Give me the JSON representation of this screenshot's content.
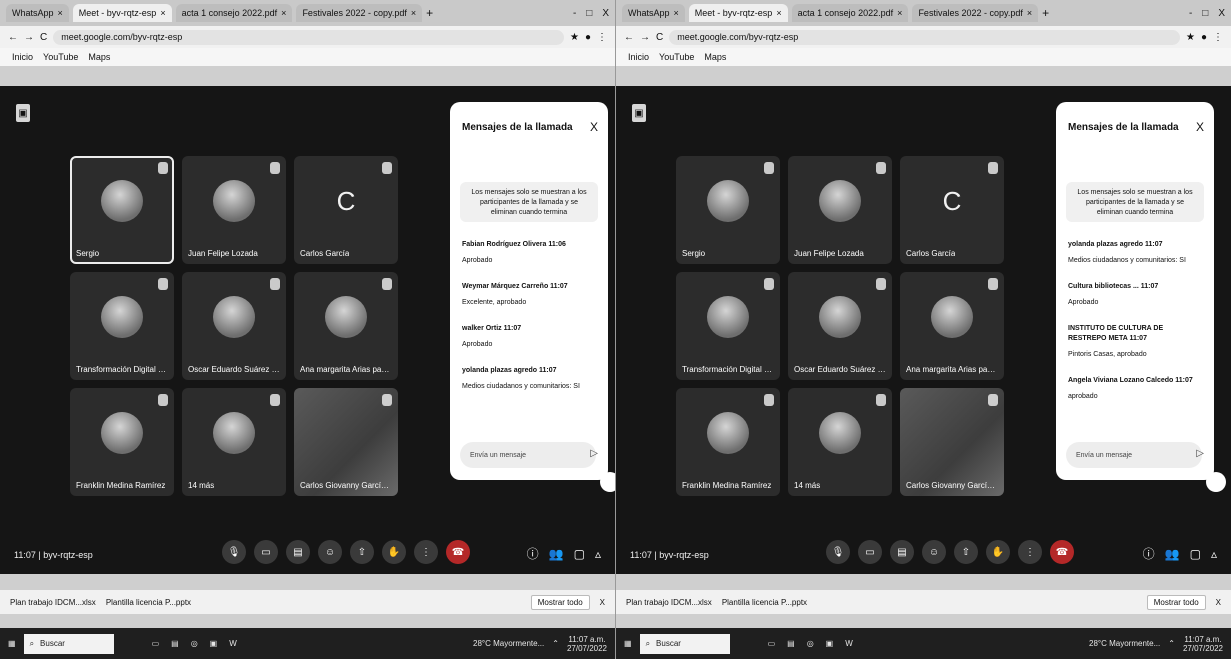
{
  "browser": {
    "tabs": [
      "WhatsApp",
      "Meet - byv-rqtz-esp",
      "acta 1 consejo 2022.pdf",
      "Festivales 2022 - copy.pdf"
    ],
    "url": "meet.google.com/byv-rqtz-esp",
    "bookmarks": [
      "Inicio",
      "YouTube",
      "Maps"
    ],
    "window_controls": [
      "-",
      "□",
      "X"
    ]
  },
  "meet": {
    "meeting_code": "11:07 | byv-rqtz-esp",
    "participants": [
      {
        "name": "Sergio",
        "avatar": "photo"
      },
      {
        "name": "Juan Felipe Lozada",
        "avatar": "photo"
      },
      {
        "name": "Carlos García",
        "avatar": "letter",
        "letter": "C"
      },
      {
        "name": "Transformación Digital IDCM",
        "avatar": "photo"
      },
      {
        "name": "Oscar Eduardo Suárez Rodri...",
        "avatar": "photo"
      },
      {
        "name": "Ana margarita Arias pardo",
        "avatar": "photo"
      },
      {
        "name": "Franklin Medina Ramírez",
        "avatar": "photo"
      },
      {
        "name": "14 más",
        "avatar": "group"
      },
      {
        "name": "Carlos Giovanny García Marín...",
        "avatar": "video"
      }
    ],
    "controls": [
      "mic-icon",
      "camera-icon",
      "captions-icon",
      "emoji-icon",
      "present-icon",
      "hand-icon",
      "more-icon",
      "end-call-icon"
    ],
    "right_controls": [
      "info-icon",
      "people-icon",
      "chat-icon",
      "activities-icon"
    ]
  },
  "chat": {
    "title": "Mensajes de la llamada",
    "close": "X",
    "notice": "Los mensajes solo se muestran a los participantes de la llamada y se eliminan cuando termina",
    "input_placeholder": "Envía un mensaje",
    "messages_left": [
      {
        "sender": "Fabian Rodríguez Olivera 11:06",
        "text": "Aprobado"
      },
      {
        "sender": "Weymar Márquez Carreño 11:07",
        "text": "Excelente, aprobado"
      },
      {
        "sender": "walker Ortiz 11:07",
        "text": "Aprobado"
      },
      {
        "sender": "yolanda plazas agredo 11:07",
        "text": "Medios ciudadanos y comunitarios: SI"
      }
    ],
    "messages_right": [
      {
        "sender": "yolanda plazas agredo 11:07",
        "text": "Medios ciudadanos y comunitarios: SI"
      },
      {
        "sender": "Cultura bibliotecas ... 11:07",
        "text": "Aprobado"
      },
      {
        "sender": "INSTITUTO DE CULTURA DE RESTREPO META 11:07",
        "text": "Pintoris Casas, aprobado"
      },
      {
        "sender": "Angela Viviana Lozano Calcedo 11:07",
        "text": "aprobado"
      }
    ]
  },
  "downloads": {
    "items": [
      "Plan trabajo IDCM...xlsx",
      "Plantilla licencia P...pptx"
    ],
    "show_all": "Mostrar todo"
  },
  "taskbar": {
    "search_placeholder": "Buscar",
    "weather": "28°C Mayormente...",
    "clock_time": "11:07 a.m.",
    "clock_date": "27/07/2022"
  }
}
